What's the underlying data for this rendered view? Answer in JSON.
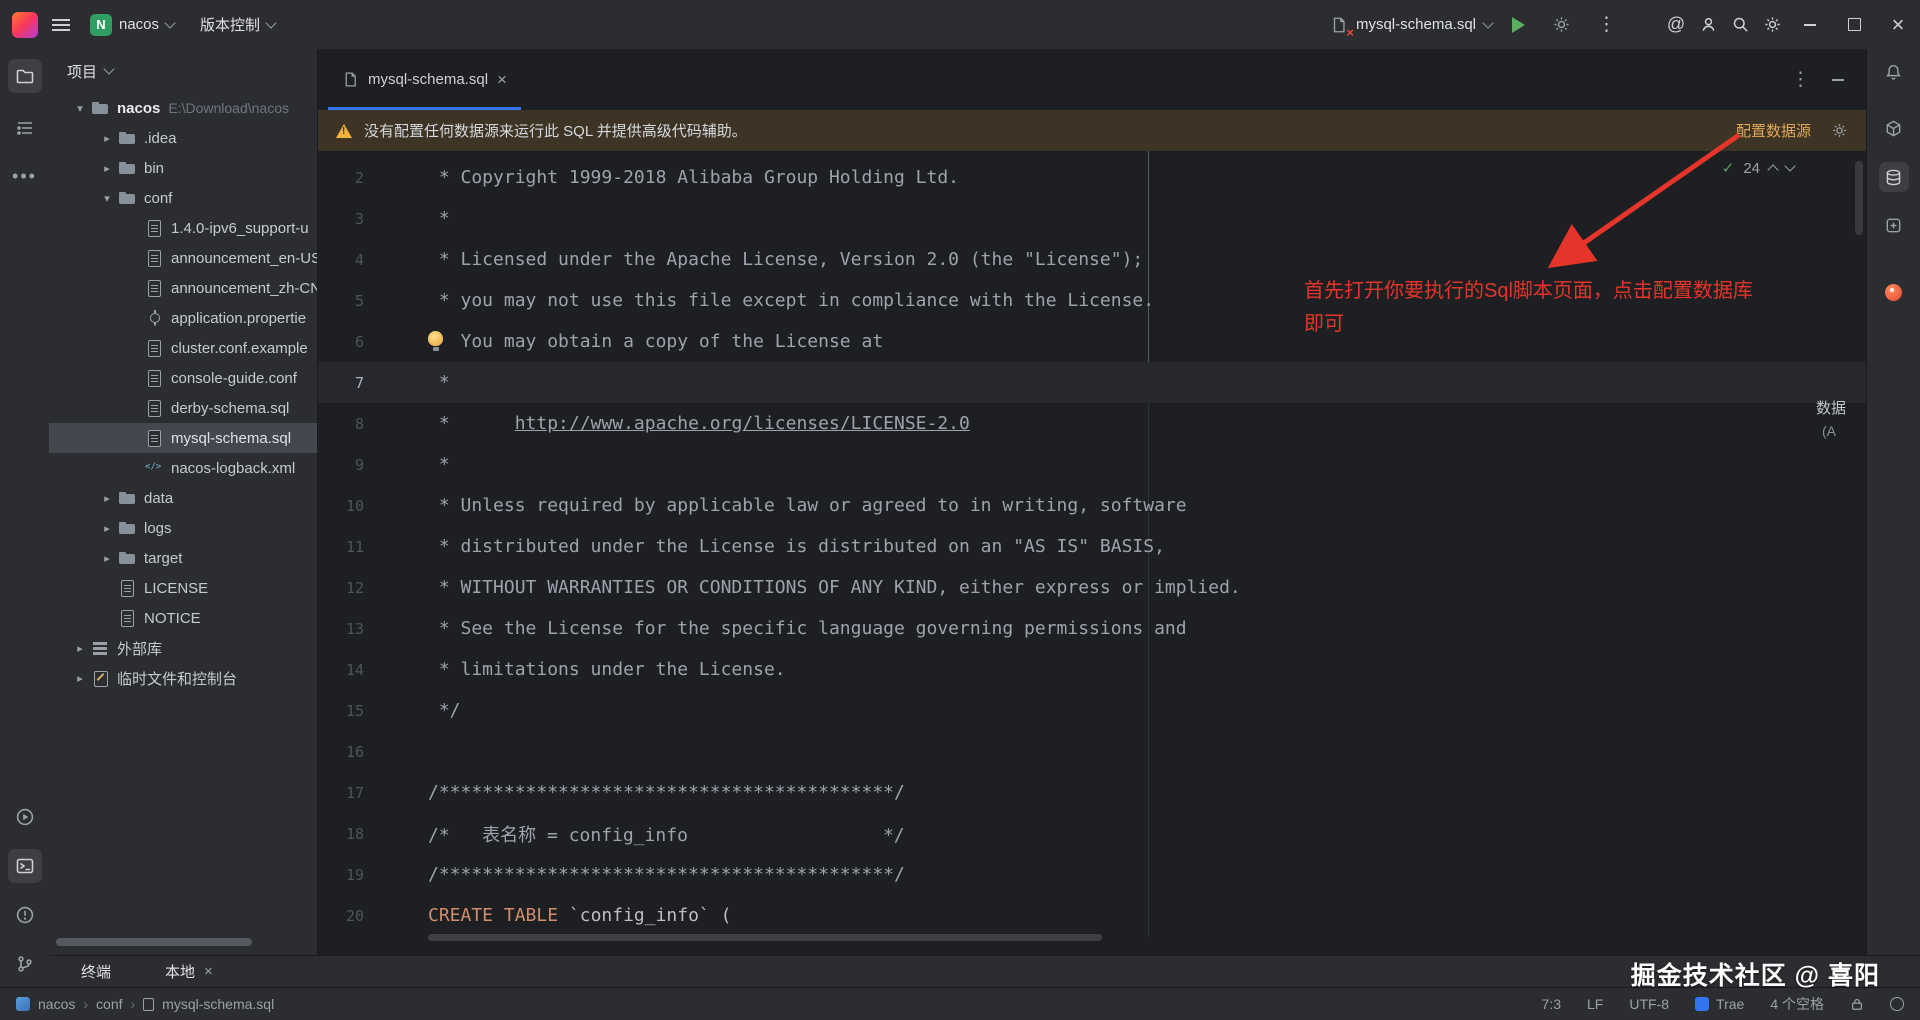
{
  "icons": {
    "chevron_down": "▾",
    "chevron_right": "▸",
    "close": "×",
    "more_vertical": "⋮",
    "check": "✓",
    "at": "@"
  },
  "titlebar": {
    "project": "nacos",
    "project_letter": "N",
    "vcs": "版本控制",
    "run_config": "mysql-schema.sql"
  },
  "project_panel": {
    "title": "项目",
    "tree": [
      {
        "label": "nacos",
        "hint": "E:\\Download\\nacos",
        "level": 0,
        "icon": "folder",
        "chevron": "down",
        "bold": true
      },
      {
        "label": ".idea",
        "level": 1,
        "icon": "folder",
        "chevron": "right"
      },
      {
        "label": "bin",
        "level": 1,
        "icon": "folder",
        "chevron": "right"
      },
      {
        "label": "conf",
        "level": 1,
        "icon": "folder",
        "chevron": "down"
      },
      {
        "label": "1.4.0-ipv6_support-u",
        "level": 2,
        "icon": "file"
      },
      {
        "label": "announcement_en-US",
        "level": 2,
        "icon": "file"
      },
      {
        "label": "announcement_zh-CN",
        "level": 2,
        "icon": "file"
      },
      {
        "label": "application.propertie",
        "level": 2,
        "icon": "gear"
      },
      {
        "label": "cluster.conf.example",
        "level": 2,
        "icon": "file"
      },
      {
        "label": "console-guide.conf",
        "level": 2,
        "icon": "file"
      },
      {
        "label": "derby-schema.sql",
        "level": 2,
        "icon": "file"
      },
      {
        "label": "mysql-schema.sql",
        "level": 2,
        "icon": "file",
        "selected": true
      },
      {
        "label": "nacos-logback.xml",
        "level": 2,
        "icon": "xml"
      },
      {
        "label": "data",
        "level": 1,
        "icon": "folder",
        "chevron": "right"
      },
      {
        "label": "logs",
        "level": 1,
        "icon": "folder",
        "chevron": "right"
      },
      {
        "label": "target",
        "level": 1,
        "icon": "folder",
        "chevron": "right"
      },
      {
        "label": "LICENSE",
        "level": 1,
        "icon": "file"
      },
      {
        "label": "NOTICE",
        "level": 1,
        "icon": "file"
      },
      {
        "label": "外部库",
        "level": 0,
        "icon": "lib",
        "chevron": "right"
      },
      {
        "label": "临时文件和控制台",
        "level": 0,
        "icon": "scratch",
        "chevron": "right"
      }
    ]
  },
  "editor": {
    "tab": "mysql-schema.sql",
    "banner": {
      "text": "没有配置任何数据源来运行此 SQL 并提供高级代码辅助。",
      "action": "配置数据源"
    },
    "inspections": "24",
    "annotation_line1": "首先打开你要执行的Sql脚本页面，点击配置数据库",
    "annotation_line2": "即可",
    "edge_fragments": [
      "数据",
      "(A"
    ],
    "lines": [
      {
        "n": 2,
        "seg": [
          [
            "c",
            " * Copyright 1999-2018 Alibaba Group Holding Ltd."
          ]
        ]
      },
      {
        "n": 3,
        "seg": [
          [
            "c",
            " *"
          ]
        ]
      },
      {
        "n": 4,
        "seg": [
          [
            "c",
            " * Licensed under the Apache License, Version 2.0 (the \"License\");"
          ]
        ]
      },
      {
        "n": 5,
        "seg": [
          [
            "c",
            " * you may not use this file except in compliance with the License."
          ]
        ]
      },
      {
        "n": 6,
        "seg": [
          [
            "c",
            " * You may obtain a copy of the License at"
          ]
        ],
        "bulb": true
      },
      {
        "n": 7,
        "seg": [
          [
            "c",
            " *"
          ]
        ],
        "current": true
      },
      {
        "n": 8,
        "seg": [
          [
            "c",
            " *      "
          ],
          [
            "l",
            "http://www.apache.org/licenses/LICENSE-2.0"
          ]
        ]
      },
      {
        "n": 9,
        "seg": [
          [
            "c",
            " *"
          ]
        ]
      },
      {
        "n": 10,
        "seg": [
          [
            "c",
            " * Unless required by applicable law or agreed to in writing, software"
          ]
        ]
      },
      {
        "n": 11,
        "seg": [
          [
            "c",
            " * distributed under the License is distributed on an \"AS IS\" BASIS,"
          ]
        ]
      },
      {
        "n": 12,
        "seg": [
          [
            "c",
            " * WITHOUT WARRANTIES OR CONDITIONS OF ANY KIND, either express or implied."
          ]
        ]
      },
      {
        "n": 13,
        "seg": [
          [
            "c",
            " * See the License for the specific language governing permissions and"
          ]
        ]
      },
      {
        "n": 14,
        "seg": [
          [
            "c",
            " * limitations under the License."
          ]
        ]
      },
      {
        "n": 15,
        "seg": [
          [
            "c",
            " */"
          ]
        ]
      },
      {
        "n": 16,
        "seg": []
      },
      {
        "n": 17,
        "seg": [
          [
            "c",
            "/******************************************/"
          ]
        ]
      },
      {
        "n": 18,
        "seg": [
          [
            "c",
            "/*   表名称 = config_info                  */"
          ]
        ]
      },
      {
        "n": 19,
        "seg": [
          [
            "c",
            "/******************************************/"
          ]
        ]
      },
      {
        "n": 20,
        "seg": [
          [
            "k",
            "CREATE TABLE "
          ],
          [
            "p",
            "`config_info` ("
          ]
        ]
      }
    ]
  },
  "terminal_bar": {
    "title": "终端",
    "tab": "本地"
  },
  "statusbar": {
    "breadcrumbs": [
      "nacos",
      "conf",
      "mysql-schema.sql"
    ],
    "caret": "7:3",
    "line_ending": "LF",
    "encoding": "UTF-8",
    "ide_badge": "Trae",
    "indent": "4 个空格"
  },
  "watermark": "掘金技术社区 @ 喜阳",
  "colors": {
    "accent": "#3574f0",
    "banner_bg": "#3d3425",
    "banner_link": "#dfa959",
    "annotation_red": "#e5352b",
    "run_green": "#5cad64",
    "keyword_orange": "#cf8e6d"
  }
}
